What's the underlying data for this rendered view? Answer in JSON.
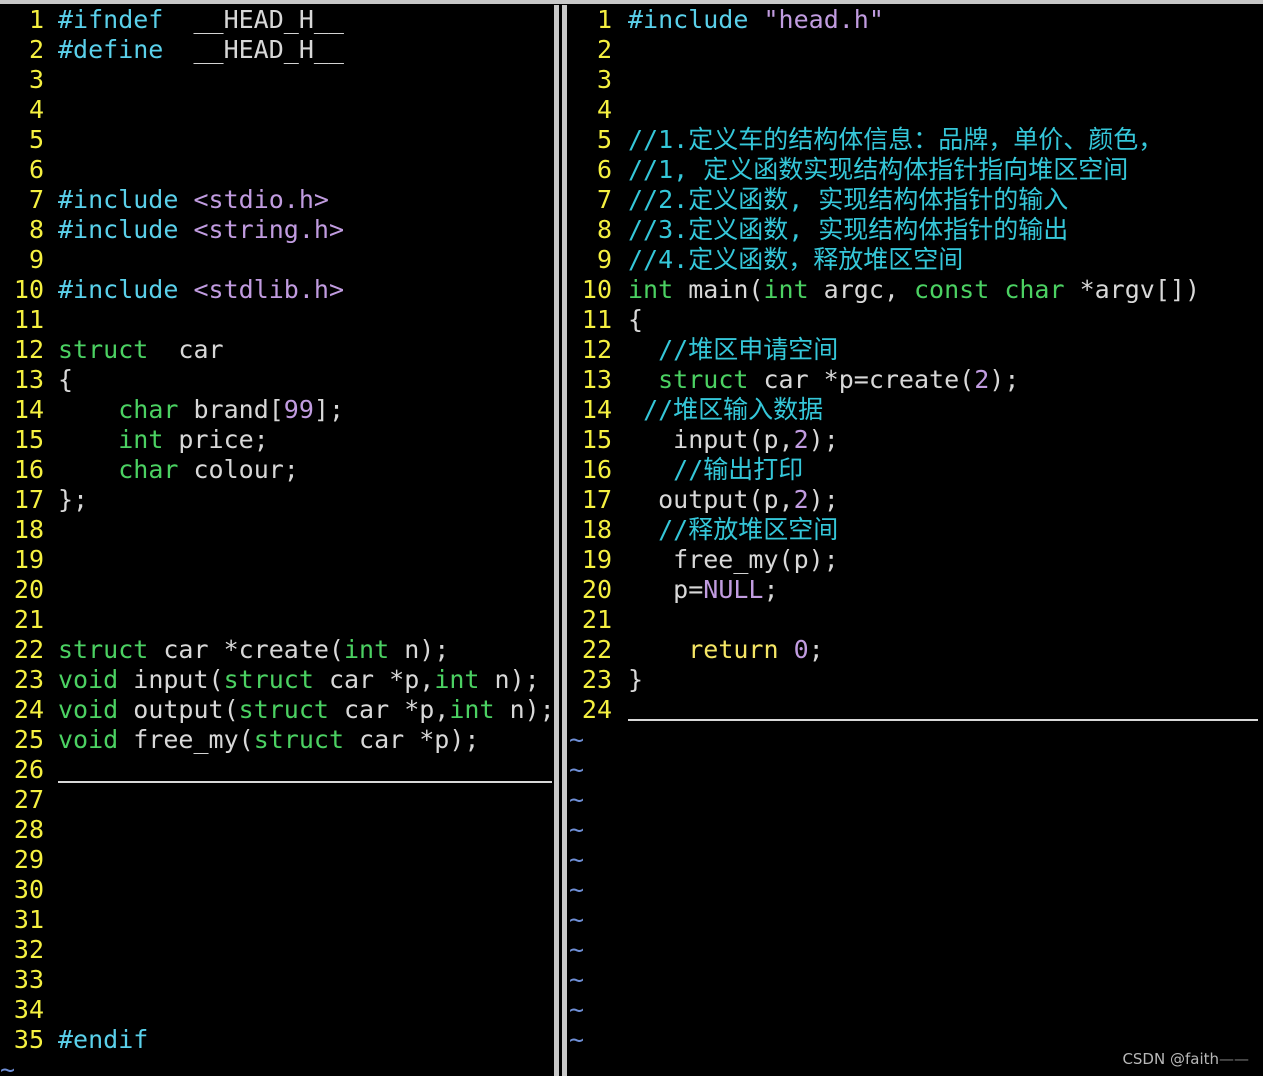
{
  "left_pane": {
    "lines": [
      {
        "n": "1",
        "tokens": [
          [
            "pp",
            "#ifndef"
          ],
          [
            "id",
            "  __HEAD_H__"
          ]
        ]
      },
      {
        "n": "2",
        "tokens": [
          [
            "pp",
            "#define"
          ],
          [
            "id",
            "  __HEAD_H__"
          ]
        ]
      },
      {
        "n": "3",
        "tokens": []
      },
      {
        "n": "4",
        "tokens": []
      },
      {
        "n": "5",
        "tokens": []
      },
      {
        "n": "6",
        "tokens": []
      },
      {
        "n": "7",
        "tokens": [
          [
            "pp",
            "#include"
          ],
          [
            "id",
            " "
          ],
          [
            "str",
            "<stdio.h>"
          ]
        ]
      },
      {
        "n": "8",
        "tokens": [
          [
            "pp",
            "#include"
          ],
          [
            "id",
            " "
          ],
          [
            "str",
            "<string.h>"
          ]
        ]
      },
      {
        "n": "9",
        "tokens": []
      },
      {
        "n": "10",
        "tokens": [
          [
            "pp",
            "#include"
          ],
          [
            "id",
            " "
          ],
          [
            "str",
            "<stdlib.h>"
          ]
        ]
      },
      {
        "n": "11",
        "tokens": []
      },
      {
        "n": "12",
        "tokens": [
          [
            "ty",
            "struct"
          ],
          [
            "id",
            "  car"
          ]
        ]
      },
      {
        "n": "13",
        "tokens": [
          [
            "id",
            "{"
          ]
        ]
      },
      {
        "n": "14",
        "tokens": [
          [
            "id",
            "    "
          ],
          [
            "ty",
            "char"
          ],
          [
            "id",
            " brand["
          ],
          [
            "num",
            "99"
          ],
          [
            "id",
            "];"
          ]
        ]
      },
      {
        "n": "15",
        "tokens": [
          [
            "id",
            "    "
          ],
          [
            "ty",
            "int"
          ],
          [
            "id",
            " price;"
          ]
        ]
      },
      {
        "n": "16",
        "tokens": [
          [
            "id",
            "    "
          ],
          [
            "ty",
            "char"
          ],
          [
            "id",
            " colour;"
          ]
        ]
      },
      {
        "n": "17",
        "tokens": [
          [
            "id",
            "};"
          ]
        ]
      },
      {
        "n": "18",
        "tokens": []
      },
      {
        "n": "19",
        "tokens": []
      },
      {
        "n": "20",
        "tokens": []
      },
      {
        "n": "21",
        "tokens": []
      },
      {
        "n": "22",
        "tokens": [
          [
            "ty",
            "struct"
          ],
          [
            "id",
            " car *create("
          ],
          [
            "ty",
            "int"
          ],
          [
            "id",
            " n);"
          ]
        ]
      },
      {
        "n": "23",
        "tokens": [
          [
            "ty",
            "void"
          ],
          [
            "id",
            " input("
          ],
          [
            "ty",
            "struct"
          ],
          [
            "id",
            " car *p,"
          ],
          [
            "ty",
            "int"
          ],
          [
            "id",
            " n);"
          ]
        ]
      },
      {
        "n": "24",
        "tokens": [
          [
            "ty",
            "void"
          ],
          [
            "id",
            " output("
          ],
          [
            "ty",
            "struct"
          ],
          [
            "id",
            " car *p,"
          ],
          [
            "ty",
            "int"
          ],
          [
            "id",
            " n);"
          ]
        ]
      },
      {
        "n": "25",
        "tokens": [
          [
            "ty",
            "void"
          ],
          [
            "id",
            " free_my("
          ],
          [
            "ty",
            "struct"
          ],
          [
            "id",
            " car *p);"
          ]
        ]
      },
      {
        "n": "26",
        "tokens": []
      },
      {
        "n": "27",
        "tokens": []
      },
      {
        "n": "28",
        "tokens": []
      },
      {
        "n": "29",
        "tokens": []
      },
      {
        "n": "30",
        "tokens": []
      },
      {
        "n": "31",
        "tokens": []
      },
      {
        "n": "32",
        "tokens": []
      },
      {
        "n": "33",
        "tokens": []
      },
      {
        "n": "34",
        "tokens": []
      },
      {
        "n": "35",
        "tokens": [
          [
            "pp",
            "#endif"
          ]
        ]
      }
    ],
    "tilde_lines": 1
  },
  "right_pane": {
    "lines": [
      {
        "n": "1",
        "tokens": [
          [
            "pp",
            "#include"
          ],
          [
            "id",
            " "
          ],
          [
            "str",
            "\"head.h\""
          ]
        ]
      },
      {
        "n": "2",
        "tokens": []
      },
      {
        "n": "3",
        "tokens": []
      },
      {
        "n": "4",
        "tokens": []
      },
      {
        "n": "5",
        "tokens": [
          [
            "cm",
            "//1.定义车的结构体信息：品牌，单价、颜色，"
          ]
        ]
      },
      {
        "n": "6",
        "tokens": [
          [
            "cm",
            "//1, 定义函数实现结构体指针指向堆区空间"
          ]
        ]
      },
      {
        "n": "7",
        "tokens": [
          [
            "cm",
            "//2.定义函数, 实现结构体指针的输入"
          ]
        ]
      },
      {
        "n": "8",
        "tokens": [
          [
            "cm",
            "//3.定义函数, 实现结构体指针的输出"
          ]
        ]
      },
      {
        "n": "9",
        "tokens": [
          [
            "cm",
            "//4.定义函数，释放堆区空间"
          ]
        ]
      },
      {
        "n": "10",
        "tokens": [
          [
            "ty",
            "int"
          ],
          [
            "id",
            " main("
          ],
          [
            "ty",
            "int"
          ],
          [
            "id",
            " argc, "
          ],
          [
            "ty",
            "const"
          ],
          [
            "id",
            " "
          ],
          [
            "ty",
            "char"
          ],
          [
            "id",
            " *argv[])"
          ]
        ]
      },
      {
        "n": "11",
        "tokens": [
          [
            "id",
            "{"
          ]
        ]
      },
      {
        "n": "12",
        "tokens": [
          [
            "id",
            "  "
          ],
          [
            "cm",
            "//堆区申请空间"
          ]
        ]
      },
      {
        "n": "13",
        "tokens": [
          [
            "id",
            "  "
          ],
          [
            "ty",
            "struct"
          ],
          [
            "id",
            " car *p=create("
          ],
          [
            "num",
            "2"
          ],
          [
            "id",
            ");"
          ]
        ]
      },
      {
        "n": "14",
        "tokens": [
          [
            "id",
            " "
          ],
          [
            "cm",
            "//堆区输入数据"
          ]
        ]
      },
      {
        "n": "15",
        "tokens": [
          [
            "id",
            "   input(p,"
          ],
          [
            "num",
            "2"
          ],
          [
            "id",
            ");"
          ]
        ]
      },
      {
        "n": "16",
        "tokens": [
          [
            "id",
            "   "
          ],
          [
            "cm",
            "//输出打印"
          ]
        ]
      },
      {
        "n": "17",
        "tokens": [
          [
            "id",
            "  output(p,"
          ],
          [
            "num",
            "2"
          ],
          [
            "id",
            ");"
          ]
        ]
      },
      {
        "n": "18",
        "tokens": [
          [
            "id",
            "  "
          ],
          [
            "cm",
            "//释放堆区空间"
          ]
        ]
      },
      {
        "n": "19",
        "tokens": [
          [
            "id",
            "   free_my(p);"
          ]
        ]
      },
      {
        "n": "20",
        "tokens": [
          [
            "id",
            "   p="
          ],
          [
            "num",
            "NULL"
          ],
          [
            "id",
            ";"
          ]
        ]
      },
      {
        "n": "21",
        "tokens": []
      },
      {
        "n": "22",
        "tokens": [
          [
            "id",
            "    "
          ],
          [
            "kw",
            "return"
          ],
          [
            "id",
            " "
          ],
          [
            "num",
            "0"
          ],
          [
            "id",
            ";"
          ]
        ]
      },
      {
        "n": "23",
        "tokens": [
          [
            "id",
            "}"
          ]
        ]
      },
      {
        "n": "24",
        "tokens": []
      }
    ],
    "tilde_lines": 11
  },
  "tilde_char": "~",
  "watermark": {
    "text": "CSDN @faith",
    "dash": "——"
  },
  "colors": {
    "line_number": "#f5f040",
    "type": "#4bd162",
    "preproc": "#5ad0ea",
    "string": "#c19ce0",
    "comment": "#35c7d9",
    "statement": "#f5e665",
    "tilde": "#6f8fd6",
    "background": "#000000"
  }
}
